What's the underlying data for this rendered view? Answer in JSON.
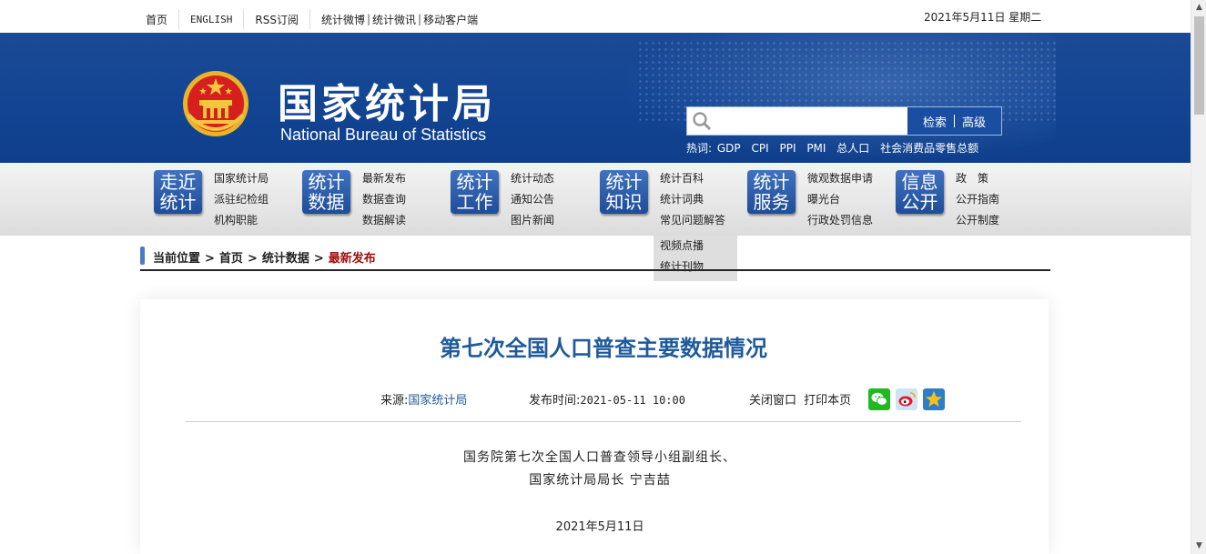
{
  "topbar": {
    "links": [
      "首页",
      "ENGLISH",
      "RSS订阅",
      "统计微博",
      "统计微讯",
      "移动客户端"
    ],
    "date": "2021年5月11日 星期二"
  },
  "header": {
    "site_title_cn": "国家统计局",
    "site_title_en": "National Bureau of Statistics",
    "search": {
      "placeholder": "",
      "search_label": "检索",
      "advanced_label": "高级"
    },
    "hot": {
      "label": "热词:",
      "terms": [
        "GDP",
        "CPI",
        "PPI",
        "PMI",
        "总人口",
        "社会消费品零售总额"
      ]
    }
  },
  "nav": {
    "groups": [
      {
        "box": [
          "走近",
          "统计"
        ],
        "links": [
          "国家统计局",
          "派驻纪检组",
          "机构职能"
        ]
      },
      {
        "box": [
          "统计",
          "数据"
        ],
        "links": [
          "最新发布",
          "数据查询",
          "数据解读"
        ]
      },
      {
        "box": [
          "统计",
          "工作"
        ],
        "links": [
          "统计动态",
          "通知公告",
          "图片新闻"
        ]
      },
      {
        "box": [
          "统计",
          "知识"
        ],
        "links": [
          "统计百科",
          "统计词典",
          "常见问题解答"
        ]
      },
      {
        "box": [
          "统计",
          "服务"
        ],
        "links": [
          "微观数据申请",
          "曝光台",
          "行政处罚信息"
        ]
      },
      {
        "box": [
          "信息",
          "公开"
        ],
        "links": [
          "政　策",
          "公开指南",
          "公开制度"
        ]
      }
    ],
    "dropdown": [
      "视频点播",
      "统计刊物"
    ]
  },
  "breadcrumb": {
    "label": "当前位置",
    "items": [
      "首页",
      "统计数据"
    ],
    "current": "最新发布"
  },
  "article": {
    "title": "第七次全国人口普查主要数据情况",
    "source_label": "来源:",
    "source": "国家统计局",
    "time_label": "发布时间:",
    "time": "2021-05-11 10:00",
    "close_label": "关闭窗口",
    "print_label": "打印本页",
    "author_line1": "国务院第七次全国人口普查领导小组副组长、",
    "author_line2": "国家统计局局长 宁吉喆",
    "date": "2021年5月11日"
  },
  "colors": {
    "banner": "#134594",
    "title": "#1f5a9a",
    "current_crumb": "#a10f0f"
  }
}
